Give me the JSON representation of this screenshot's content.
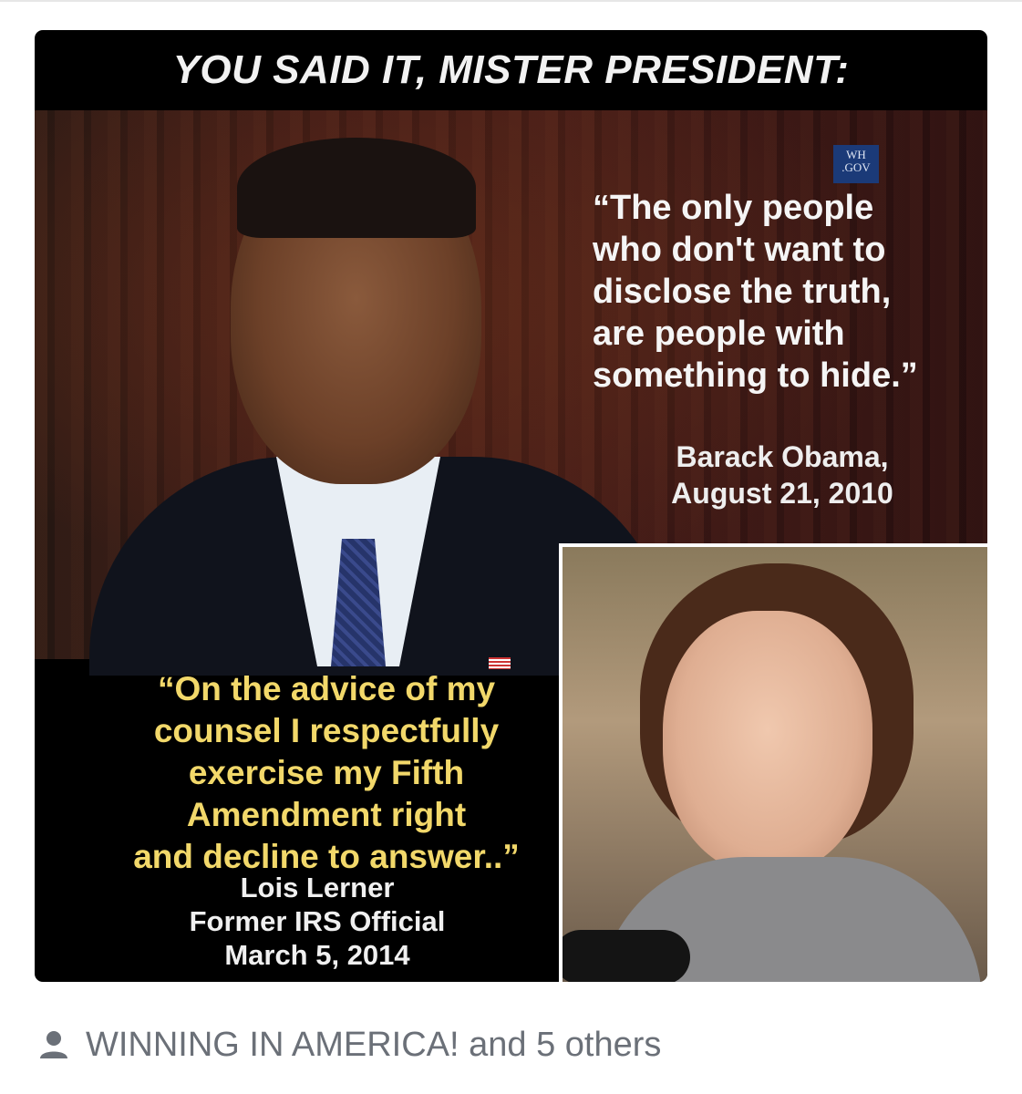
{
  "post": {
    "headline": "YOU SAID IT, MISTER PRESIDENT:",
    "watermark": "WH\n.GOV",
    "quote_obama": "“The only people\nwho don't want to\ndisclose the truth,\nare people with\nsomething to hide.”",
    "attrib_obama": "Barack Obama,\nAugust 21, 2010",
    "quote_lerner": "“On the advice of my\ncounsel I respectfully\nexercise my Fifth\nAmendment right\nand decline to answer..”",
    "attrib_lerner": "Lois Lerner\nFormer IRS Official\nMarch 5, 2014"
  },
  "footer": {
    "shared_by": "WINNING IN AMERICA! and 5 others",
    "icon": "person-icon"
  },
  "colors": {
    "quote_yellow": "#f2d86a",
    "footer_gray": "#6b7078"
  }
}
